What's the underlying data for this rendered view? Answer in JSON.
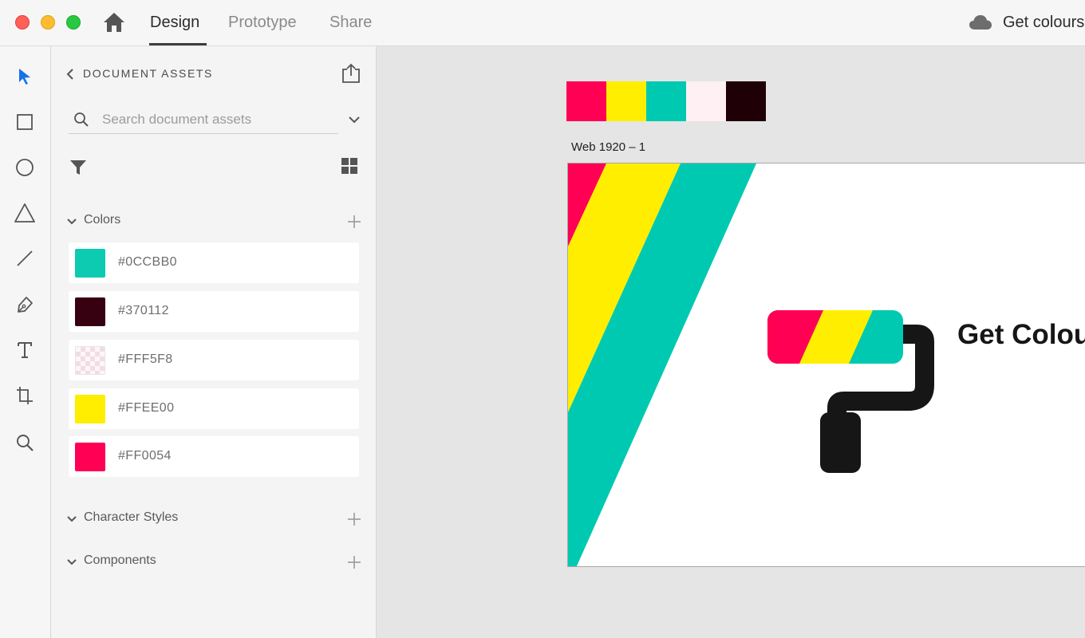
{
  "window": {
    "tabs": [
      {
        "label": "Design",
        "active": true
      },
      {
        "label": "Prototype",
        "active": false
      },
      {
        "label": "Share",
        "active": false
      }
    ],
    "document_title": "Get colours"
  },
  "tools": [
    "select-tool",
    "rectangle-tool",
    "ellipse-tool",
    "polygon-tool",
    "line-tool",
    "pen-tool",
    "text-tool",
    "artboard-tool",
    "zoom-tool"
  ],
  "assets_panel": {
    "title": "DOCUMENT ASSETS",
    "search_placeholder": "Search document assets",
    "sections": {
      "colors": {
        "label": "Colors"
      },
      "character_styles": {
        "label": "Character Styles"
      },
      "components": {
        "label": "Components"
      }
    },
    "colors": [
      {
        "hex": "#0CCBB0",
        "value": "#0CCBB0"
      },
      {
        "hex": "#370112",
        "value": "#370112"
      },
      {
        "hex": "#FFF5F8",
        "value": "#FFF5F8"
      },
      {
        "hex": "#FFEE00",
        "value": "#FFEE00"
      },
      {
        "hex": "#FF0054",
        "value": "#FF0054"
      }
    ]
  },
  "canvas": {
    "palette": [
      "#FF0054",
      "#FFEE00",
      "#00C9B1",
      "#FFF0F4",
      "#200007"
    ],
    "artboard_name": "Web 1920 – 1",
    "hero_title": "Get Colours"
  },
  "colors": {
    "accent_blue": "#1473e6",
    "pink": "#FF0054",
    "yellow": "#FFEE00",
    "teal": "#00C9B1",
    "dark": "#161616"
  }
}
